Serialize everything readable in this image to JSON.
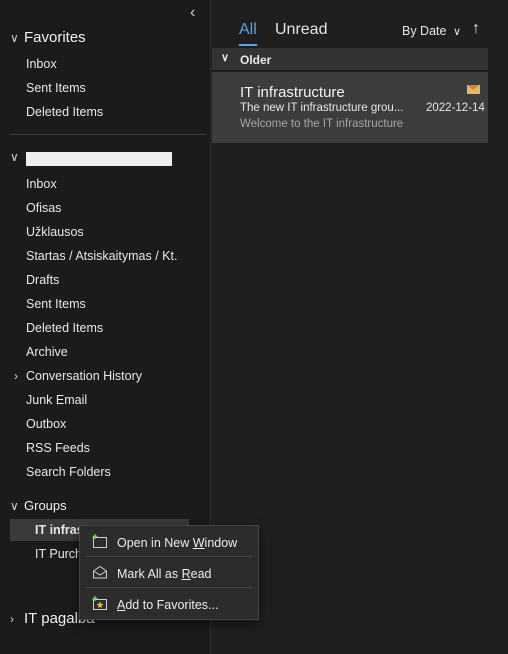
{
  "sidebar": {
    "collapse_icon": "chevron-left-icon",
    "favorites": {
      "title": "Favorites",
      "items": [
        "Inbox",
        "Sent Items",
        "Deleted Items"
      ]
    },
    "account": {
      "items": [
        "Inbox",
        "Ofisas",
        "Užklausos",
        "Startas / Atsiskaitymas / Kt.",
        "Drafts",
        "Sent Items",
        "Deleted Items",
        "Archive",
        "Conversation History",
        "Junk Email",
        "Outbox",
        "RSS Feeds",
        "Search Folders"
      ]
    },
    "groups": {
      "title": "Groups",
      "items": [
        "IT infras",
        "IT Purch"
      ]
    },
    "it_pagalba": "IT pagalba"
  },
  "list": {
    "tabs": {
      "all": "All",
      "unread": "Unread"
    },
    "sort_label": "By Date",
    "section": "Older",
    "mail": {
      "sender": "IT infrastructure",
      "subject": "The new IT infrastructure grou...",
      "preview": "Welcome to the IT infrastructure",
      "date": "2022-12-14"
    }
  },
  "context_menu": {
    "open": "Open in New ",
    "open_u": "W",
    "open_rest": "indow",
    "mark": "Mark All as ",
    "mark_u": "R",
    "mark_rest": "ead",
    "add_u": "A",
    "add_rest": "dd to Favorites..."
  },
  "colors": {
    "accent": "#5aa3e6",
    "selected": "#3d3d3d"
  }
}
